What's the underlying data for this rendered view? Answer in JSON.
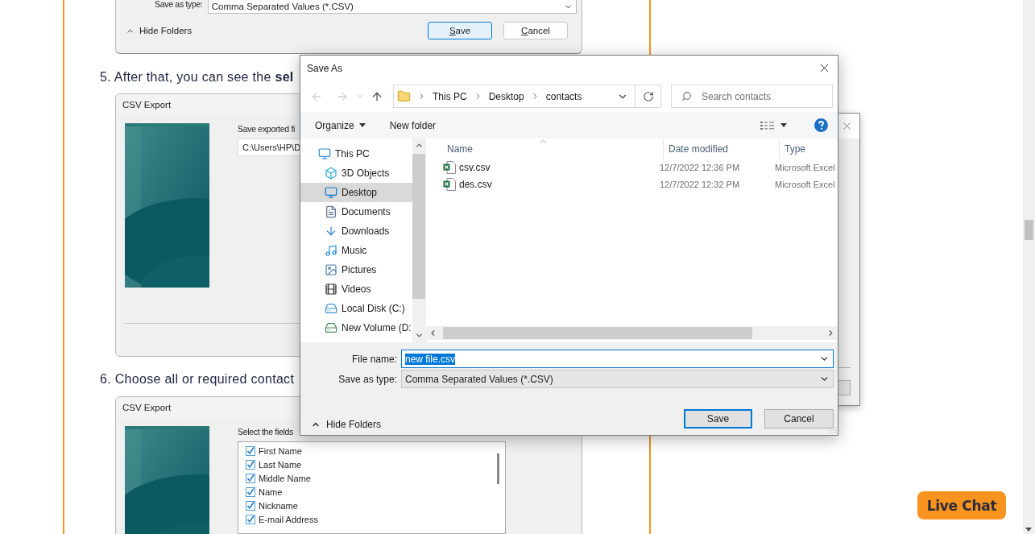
{
  "article": {
    "top_screenshot": {
      "type_label": "Save as type:",
      "type_value": "Comma Separated Values (*.CSV)",
      "hide_folders": "Hide Folders",
      "buttons": [
        {
          "label": "Save",
          "focused": true
        },
        {
          "label": "Cancel",
          "focused": false
        }
      ]
    },
    "steps": [
      {
        "number": "5.",
        "text": "After that, you can see the **sel**",
        "screenshot": {
          "kind": "path",
          "title": "CSV Export",
          "label": "Save exported fi",
          "path": "C:\\Users\\HP\\D"
        }
      },
      {
        "number": "6.",
        "text": "Choose all or required contact",
        "screenshot": {
          "kind": "fields",
          "title": "CSV Export",
          "label": "Select the fields",
          "fields": [
            {
              "label": "First Name",
              "checked": true
            },
            {
              "label": "Last Name",
              "checked": true
            },
            {
              "label": "Middle Name",
              "checked": true
            },
            {
              "label": "Name",
              "checked": true
            },
            {
              "label": "Nickname",
              "checked": true
            },
            {
              "label": "E-mail Address",
              "checked": true
            }
          ]
        }
      }
    ]
  },
  "save_dialog": {
    "title": "Save As",
    "breadcrumb": [
      "This PC",
      "Desktop",
      "contacts"
    ],
    "search_placeholder": "Search contacts",
    "toolbar": [
      {
        "label": "Organize",
        "menu": true
      },
      {
        "label": "New folder",
        "menu": false
      }
    ],
    "tree": [
      {
        "label": "This PC",
        "selected": false,
        "children": [
          {
            "label": "3D Objects",
            "selected": false
          },
          {
            "label": "Desktop",
            "selected": true
          },
          {
            "label": "Documents",
            "selected": false
          },
          {
            "label": "Downloads",
            "selected": false
          },
          {
            "label": "Music",
            "selected": false
          },
          {
            "label": "Pictures",
            "selected": false
          },
          {
            "label": "Videos",
            "selected": false
          },
          {
            "label": "Local Disk (C:)",
            "selected": false
          },
          {
            "label": "New Volume (D:",
            "selected": false
          }
        ]
      }
    ],
    "columns": [
      "Name",
      "Date modified",
      "Type"
    ],
    "files": [
      {
        "name": "csv.csv",
        "date": "12/7/2022 12:36 PM",
        "type": "Microsoft Excel"
      },
      {
        "name": "des.csv",
        "date": "12/7/2022 12:32 PM",
        "type": "Microsoft Excel"
      }
    ],
    "file_name_label": "File name:",
    "file_name": "new file.csv",
    "file_name_selected": true,
    "type_label": "Save as type:",
    "type_value": "Comma Separated Values (*.CSV)",
    "hide_folders": "Hide Folders",
    "buttons": [
      {
        "label": "Save",
        "focused": true
      },
      {
        "label": "Cancel",
        "focused": false
      }
    ]
  },
  "live_chat": "Live Chat"
}
